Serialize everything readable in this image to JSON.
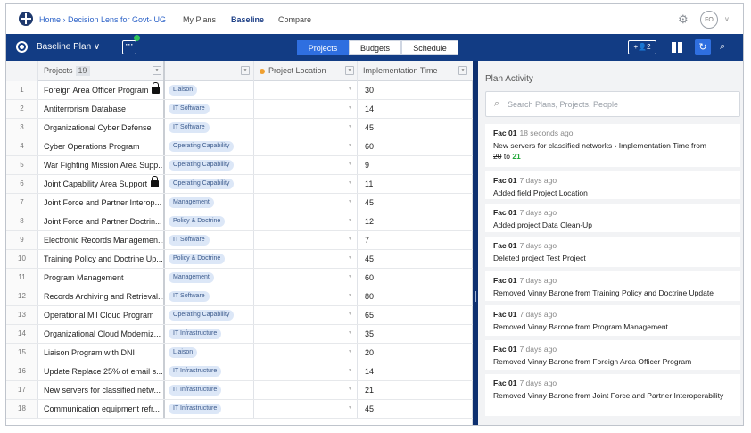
{
  "nav": {
    "breadcrumb": "Home › Decision Lens for Govt- UG",
    "my_plans": "My Plans",
    "baseline": "Baseline",
    "compare": "Compare",
    "avatar_initials": "FO"
  },
  "toolbar": {
    "plan_label": "Baseline Plan ∨",
    "more_label": "···",
    "tabs": [
      "Projects",
      "Budgets",
      "Schedule"
    ],
    "active_tab": "Projects",
    "people_count": "2"
  },
  "grid": {
    "headers": {
      "projects": "Projects",
      "projects_count": "19",
      "location": "Project Location",
      "time": "Implementation Time"
    },
    "rows": [
      {
        "num": "1",
        "name": "Foreign Area Officer Program",
        "locked": true,
        "tag": "Liaison",
        "time": "30"
      },
      {
        "num": "2",
        "name": "Antiterrorism Database",
        "locked": false,
        "tag": "IT Software",
        "time": "14"
      },
      {
        "num": "3",
        "name": "Organizational Cyber Defense",
        "locked": false,
        "tag": "IT Software",
        "time": "45"
      },
      {
        "num": "4",
        "name": "Cyber Operations Program",
        "locked": false,
        "tag": "Operating Capability",
        "time": "60"
      },
      {
        "num": "5",
        "name": "War Fighting Mission Area Supp...",
        "locked": false,
        "tag": "Operating Capability",
        "time": "9"
      },
      {
        "num": "6",
        "name": "Joint Capability Area Support",
        "locked": true,
        "tag": "Operating Capability",
        "time": "11"
      },
      {
        "num": "7",
        "name": "Joint Force and Partner Interop...",
        "locked": false,
        "tag": "Management",
        "time": "45"
      },
      {
        "num": "8",
        "name": "Joint Force and Partner Doctrin...",
        "locked": false,
        "tag": "Policy & Doctrine",
        "time": "12"
      },
      {
        "num": "9",
        "name": "Electronic Records Managemen...",
        "locked": false,
        "tag": "IT Software",
        "time": "7"
      },
      {
        "num": "10",
        "name": "Training Policy and Doctrine Up...",
        "locked": false,
        "tag": "Policy & Doctrine",
        "time": "45"
      },
      {
        "num": "11",
        "name": "Program Management",
        "locked": false,
        "tag": "Management",
        "time": "60"
      },
      {
        "num": "12",
        "name": "Records Archiving and Retrieval...",
        "locked": false,
        "tag": "IT Software",
        "time": "80"
      },
      {
        "num": "13",
        "name": "Operational Mil Cloud Program",
        "locked": false,
        "tag": "Operating Capability",
        "time": "65"
      },
      {
        "num": "14",
        "name": "Organizational Cloud Moderniz...",
        "locked": false,
        "tag": "IT Infrastructure",
        "time": "35"
      },
      {
        "num": "15",
        "name": "Liaison Program with DNI",
        "locked": false,
        "tag": "Liaison",
        "time": "20"
      },
      {
        "num": "16",
        "name": "Update Replace 25% of email s...",
        "locked": false,
        "tag": "IT Infrastructure",
        "time": "14"
      },
      {
        "num": "17",
        "name": "New servers for classified netw...",
        "locked": false,
        "tag": "IT Infrastructure",
        "time": "21"
      },
      {
        "num": "18",
        "name": "Communication equipment refr...",
        "locked": false,
        "tag": "IT Infrastructure",
        "time": "45"
      }
    ]
  },
  "activity": {
    "title": "Plan Activity",
    "search_placeholder": "Search Plans, Projects, People",
    "first": {
      "who": "Fac 01",
      "when": "18 seconds ago",
      "msg": "New servers for classified networks › Implementation Time from",
      "old_value": "20",
      "to_word": "to",
      "new_value": "21"
    },
    "items": [
      {
        "who": "Fac 01",
        "when": "7 days ago",
        "msg": "Added field Project Location"
      },
      {
        "who": "Fac 01",
        "when": "7 days ago",
        "msg": "Added project Data Clean-Up"
      },
      {
        "who": "Fac 01",
        "when": "7 days ago",
        "msg": "Deleted project Test Project"
      },
      {
        "who": "Fac 01",
        "when": "7 days ago",
        "msg": "Removed Vinny Barone from Training Policy and Doctrine Update"
      },
      {
        "who": "Fac 01",
        "when": "7 days ago",
        "msg": "Removed Vinny Barone from Program Management"
      },
      {
        "who": "Fac 01",
        "when": "7 days ago",
        "msg": "Removed Vinny Barone from Foreign Area Officer Program"
      },
      {
        "who": "Fac 01",
        "when": "7 days ago",
        "msg": "Removed Vinny Barone from Joint Force and Partner Interoperability"
      }
    ]
  }
}
